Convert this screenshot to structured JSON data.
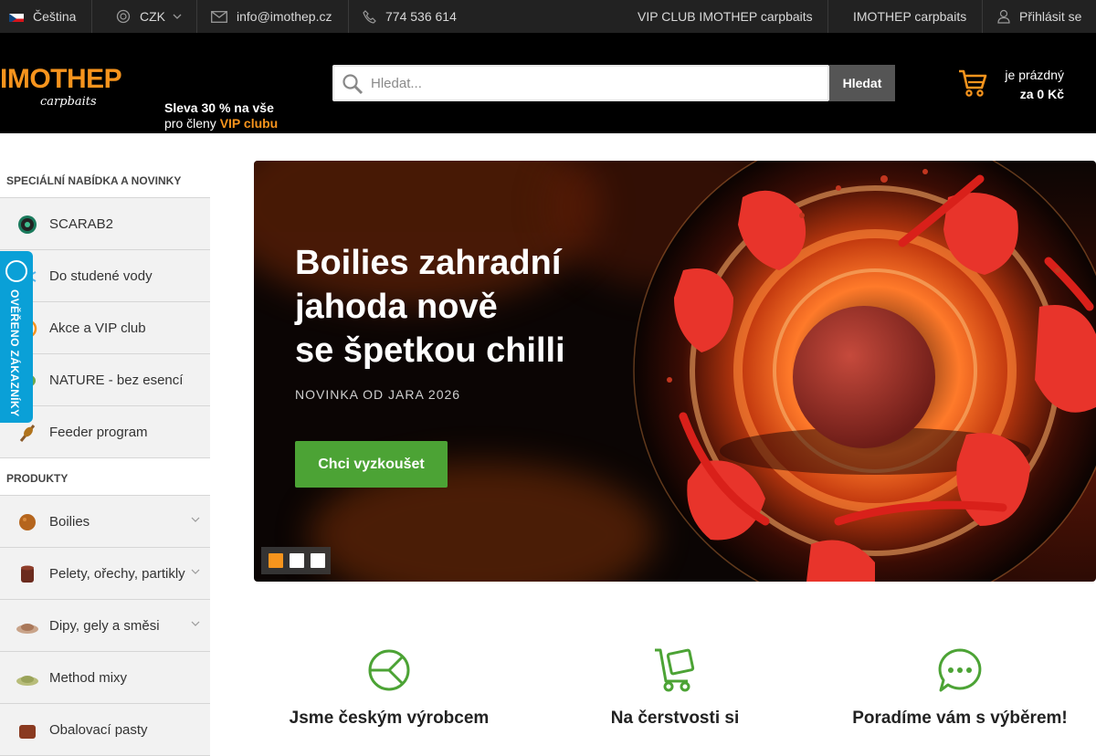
{
  "topbar": {
    "language": "Čeština",
    "currency": "CZK",
    "email": "info@imothep.cz",
    "phone": "774 536 614",
    "vip_link": "VIP CLUB IMOTHEP carpbaits",
    "brand_link": "IMOTHEP carpbaits",
    "login": "Přihlásit se"
  },
  "header": {
    "logo_main": "IMOTHEP",
    "logo_sub": "carpbaits",
    "promo_line1": "Sleva 30 % na vše",
    "promo_line2": "pro členy",
    "promo_vip": "VIP clubu",
    "search_placeholder": "Hledat...",
    "search_button": "Hledat",
    "cart_status": "je prázdný",
    "cart_total": "za 0 Kč"
  },
  "sidebar": {
    "section1": "SPECIÁLNÍ NABÍDKA A NOVINKY",
    "items1": [
      {
        "label": "SCARAB2",
        "icon": "scarab-icon"
      },
      {
        "label": "Do studené vody",
        "icon": "snowflake-icon"
      },
      {
        "label": "Akce a VIP club",
        "icon": "vip-icon"
      },
      {
        "label": "NATURE - bez esencí",
        "icon": "leaf-icon"
      },
      {
        "label": "Feeder program",
        "icon": "feeder-icon"
      }
    ],
    "section2": "PRODUKTY",
    "items2": [
      {
        "label": "Boilies",
        "icon": "boilie-icon"
      },
      {
        "label": "Pelety, ořechy, partikly",
        "icon": "pellet-icon"
      },
      {
        "label": "Dipy, gely a směsi",
        "icon": "dip-icon"
      },
      {
        "label": "Method mixy",
        "icon": "method-mix-icon"
      },
      {
        "label": "Obalovací pasty",
        "icon": "paste-icon"
      }
    ],
    "verified": "OVĚŘENO ZÁKAZNÍKY"
  },
  "hero": {
    "title_lines": [
      "Boilies zahradní",
      "jahoda nově",
      "se špetkou chilli"
    ],
    "subtitle": "NOVINKA OD JARA 2026",
    "cta": "Chci vyzkoušet",
    "active_slide": 1,
    "slide_count": 3
  },
  "features": [
    {
      "title": "Jsme českým výrobcem",
      "icon": "czech-producer-icon"
    },
    {
      "title": "Na čerstvosti si",
      "icon": "delivery-cart-icon"
    },
    {
      "title": "Poradíme vám s výběrem!",
      "icon": "chat-icon"
    }
  ],
  "colors": {
    "accent": "#f7941d",
    "green": "#4ca335",
    "verified_blue": "#0aa0d7",
    "topbar": "#222222",
    "header": "#000000"
  }
}
